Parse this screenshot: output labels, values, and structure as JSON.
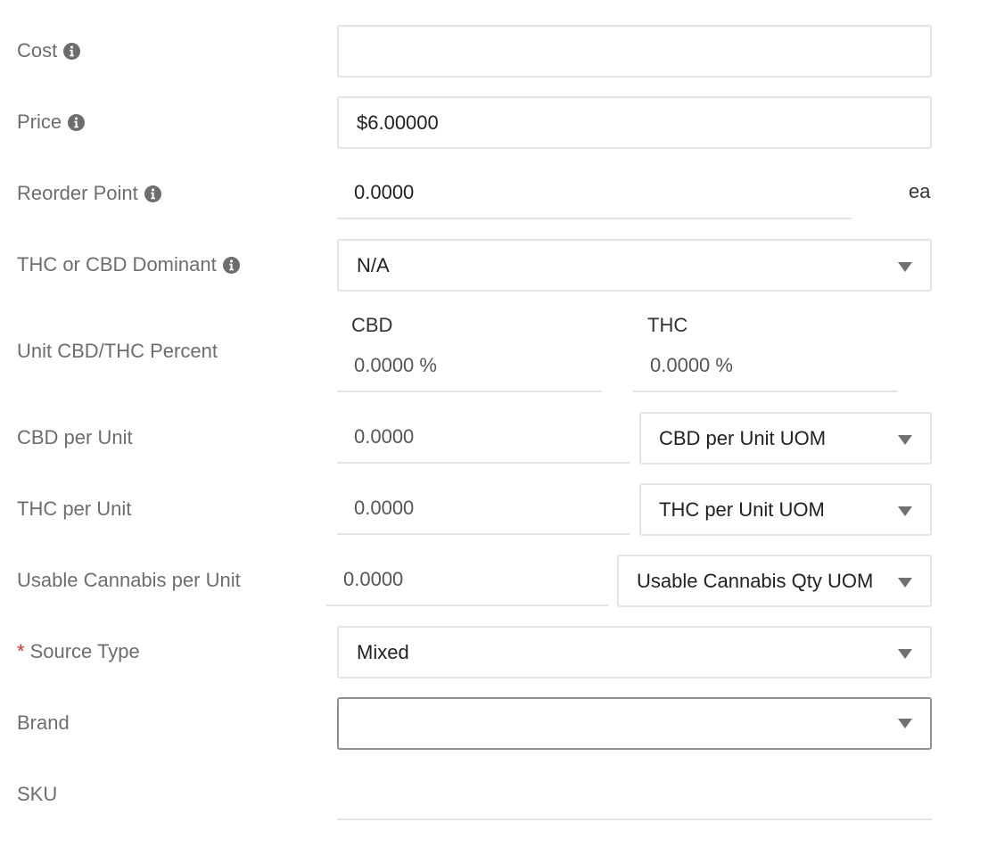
{
  "fields": {
    "cost": {
      "label": "Cost",
      "value": ""
    },
    "price": {
      "label": "Price",
      "value": "$6.00000"
    },
    "reorder_point": {
      "label": "Reorder Point",
      "value": "0.0000",
      "unit": "ea"
    },
    "dominant": {
      "label": "THC or CBD Dominant",
      "selected": "N/A"
    },
    "unit_percent": {
      "label": "Unit CBD/THC Percent",
      "cbd_label": "CBD",
      "cbd_value": "0.0000 %",
      "thc_label": "THC",
      "thc_value": "0.0000 %"
    },
    "cbd_per_unit": {
      "label": "CBD per Unit",
      "value": "0.0000",
      "uom": "CBD per Unit UOM"
    },
    "thc_per_unit": {
      "label": "THC per Unit",
      "value": "0.0000",
      "uom": "THC per Unit UOM"
    },
    "usable_cannabis": {
      "label": "Usable Cannabis per Unit",
      "value": "0.0000",
      "uom": "Usable Cannabis Qty UOM"
    },
    "source_type": {
      "required_mark": "*",
      "label": "Source Type",
      "selected": "Mixed"
    },
    "brand": {
      "label": "Brand",
      "selected": ""
    },
    "sku": {
      "label": "SKU",
      "value": ""
    }
  },
  "icons": {
    "info": "info-circle-icon",
    "dropdown": "caret-down-icon"
  },
  "colors": {
    "label": "#6d6d6d",
    "border": "#e4e4e4",
    "required": "#d0312d"
  }
}
